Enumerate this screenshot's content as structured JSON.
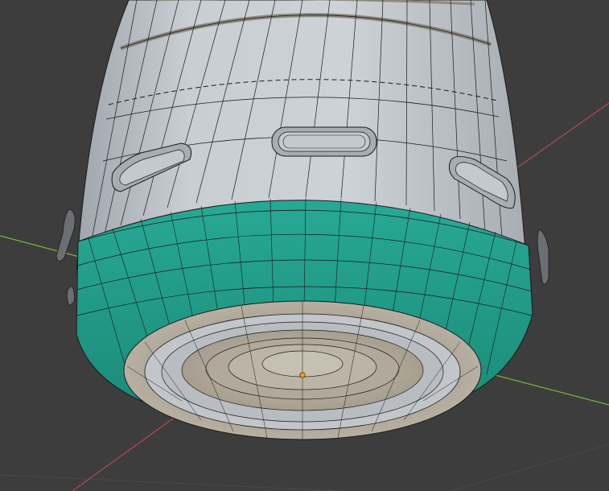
{
  "viewport": {
    "mode": "edit-mode-wireframe-overlay",
    "object": "cylindrical-mesh-bottom-cap",
    "colors": {
      "background": "#3d3d3d",
      "grid_line": "#4a4a4a",
      "x_axis": "#b8474e",
      "y_axis": "#79b43b",
      "mesh_body": "#c3c8cd",
      "mesh_shadow": "#9aa0a6",
      "selected_faces": "#1f9b88",
      "selected_faces_dark": "#177867",
      "bottom_ring": "#aaa395",
      "wire": "#1a1a1a",
      "origin_point": "#ff9a1a"
    },
    "icons": [
      "axis-x-line",
      "axis-y-line",
      "origin-dot"
    ]
  }
}
